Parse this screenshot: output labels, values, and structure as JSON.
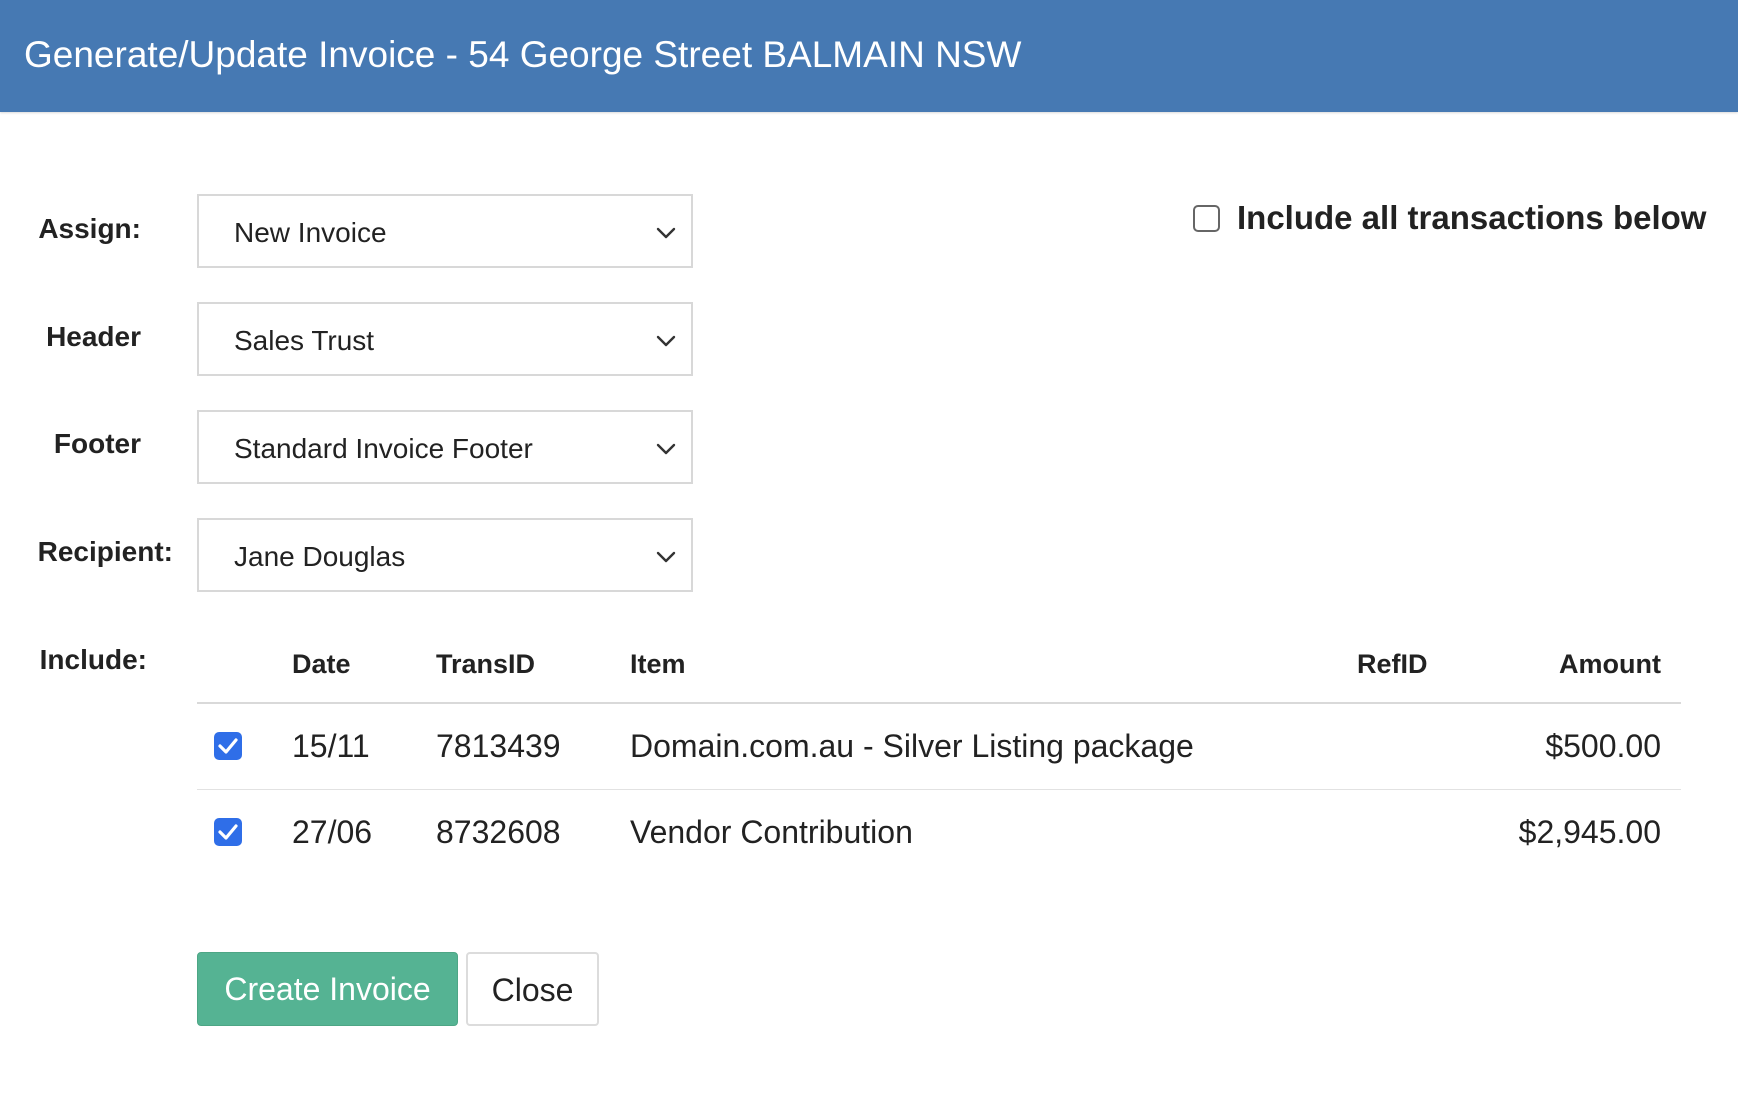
{
  "dialog": {
    "title": "Generate/Update Invoice - 54 George Street BALMAIN NSW"
  },
  "form": {
    "assign": {
      "label": "Assign:",
      "value": "New Invoice"
    },
    "header": {
      "label": "Header",
      "value": "Sales Trust"
    },
    "footer": {
      "label": "Footer",
      "value": "Standard Invoice Footer"
    },
    "recipient": {
      "label": "Recipient:",
      "value": "Jane Douglas"
    },
    "include_label": "Include:"
  },
  "include_all": {
    "label": "Include all transactions below",
    "checked": false
  },
  "table": {
    "columns": {
      "date": "Date",
      "trans_id": "TransID",
      "item": "Item",
      "ref_id": "RefID",
      "amount": "Amount"
    },
    "rows": [
      {
        "checked": true,
        "date": "15/11",
        "trans_id": "7813439",
        "item": "Domain.com.au - Silver Listing package",
        "ref_id": "",
        "amount": "$500.00"
      },
      {
        "checked": true,
        "date": "27/06",
        "trans_id": "8732608",
        "item": "Vendor Contribution",
        "ref_id": "",
        "amount": "$2,945.00"
      }
    ]
  },
  "actions": {
    "create_label": "Create Invoice",
    "close_label": "Close"
  },
  "colors": {
    "header_bg": "#4679b3",
    "primary_button": "#55b393",
    "checkbox_checked": "#2f6ee8"
  }
}
